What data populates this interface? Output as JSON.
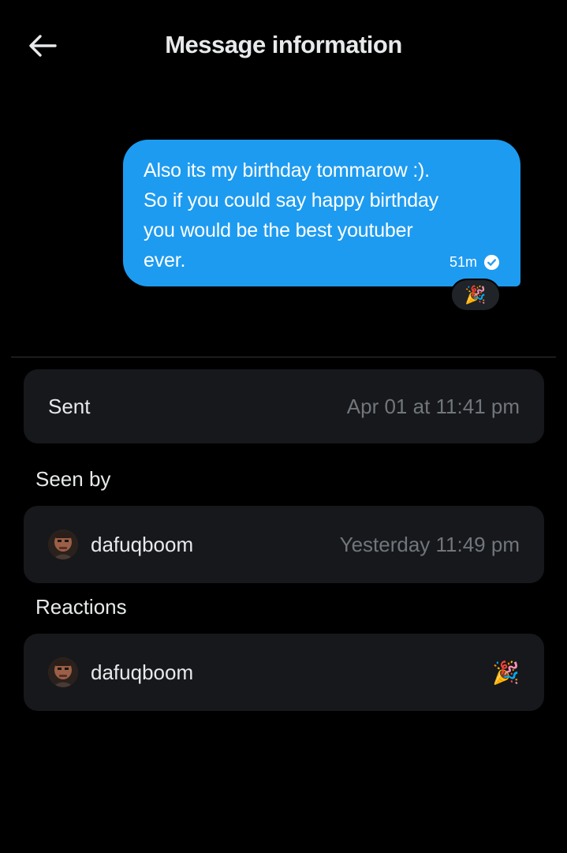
{
  "header": {
    "title": "Message information",
    "back_icon": "arrow-left-icon"
  },
  "message": {
    "text": "Also its my birthday tommarow :).\nSo if you could say happy birthday\nyou would be the best youtuber\never.",
    "time": "51m",
    "status_icon": "check-circle-icon",
    "reaction": "🎉",
    "bubble_color": "#1d9bf0"
  },
  "sent": {
    "label": "Sent",
    "value": "Apr 01 at 11:41 pm"
  },
  "seen_by": {
    "title": "Seen by",
    "user": "dafuqboom",
    "time": "Yesterday 11:49 pm"
  },
  "reactions": {
    "title": "Reactions",
    "user": "dafuqboom",
    "emoji": "🎉"
  }
}
